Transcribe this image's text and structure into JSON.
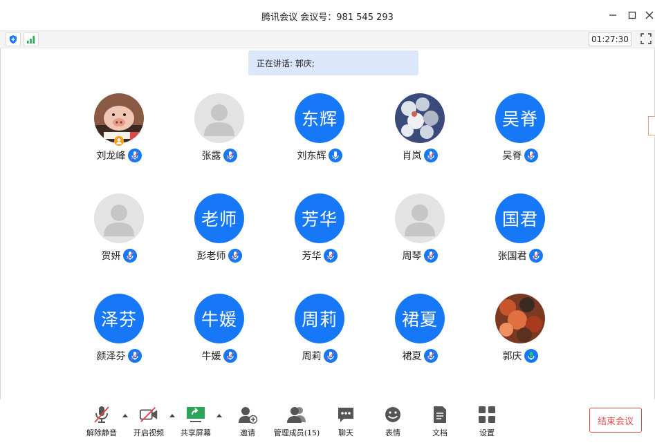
{
  "window": {
    "title": "腾讯会议 会议号：981 545 293",
    "controls": [
      "minimize",
      "maximize",
      "close"
    ]
  },
  "status": {
    "security_icon": "shield-icon",
    "signal_icon": "signal-bars-icon",
    "timer": "01:27:30",
    "fullscreen_icon": "fullscreen-icon"
  },
  "speaking": {
    "text": "正在讲话: 郭庆;"
  },
  "colors": {
    "accent": "#1677f7",
    "end": "#e04848",
    "speaking_bg": "#dbe8fb",
    "active_mic": "#2ec26b"
  },
  "participants": [
    {
      "name": "刘龙峰",
      "avatar": "photo-pig",
      "mic": "muted"
    },
    {
      "name": "张露",
      "avatar": "default",
      "mic": "muted"
    },
    {
      "name": "刘东辉",
      "avatar_text": "东辉",
      "mic": "on"
    },
    {
      "name": "肖岚",
      "avatar": "photo-balloons",
      "mic": "muted"
    },
    {
      "name": "吴脊",
      "avatar_text": "吴脊",
      "mic": "muted"
    },
    {
      "name": "贺妍",
      "avatar": "default",
      "mic": "muted"
    },
    {
      "name": "彭老师",
      "avatar_text": "老师",
      "mic": "muted"
    },
    {
      "name": "芳华",
      "avatar_text": "芳华",
      "mic": "muted"
    },
    {
      "name": "周琴",
      "avatar": "default",
      "mic": "muted"
    },
    {
      "name": "张国君",
      "avatar_text": "国君",
      "mic": "muted"
    },
    {
      "name": "颜泽芬",
      "avatar_text": "泽芬",
      "mic": "muted"
    },
    {
      "name": "牛媛",
      "avatar_text": "牛媛",
      "mic": "muted"
    },
    {
      "name": "周莉",
      "avatar_text": "周莉",
      "mic": "muted"
    },
    {
      "name": "裙夏",
      "avatar_text": "裙夏",
      "mic": "muted"
    },
    {
      "name": "郭庆",
      "avatar": "photo-autumn",
      "mic": "speaking"
    }
  ],
  "toolbar": {
    "unmute": "解除静音",
    "video": "开启视频",
    "share": "共享屏幕",
    "invite": "邀请",
    "members": "管理成员(15)",
    "chat": "聊天",
    "emoji": "表情",
    "docs": "文档",
    "settings": "设置",
    "end": "结束会议"
  }
}
